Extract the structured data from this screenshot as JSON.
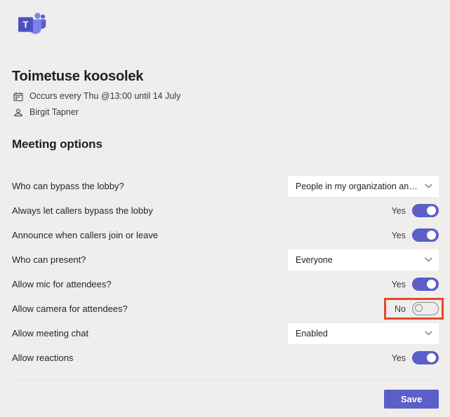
{
  "app": {
    "logo_name": "microsoft-teams-logo",
    "accent_color": "#5b5fc7",
    "background_color": "#f0eeed",
    "highlight_color": "#e8472c"
  },
  "meeting": {
    "title": "Toimetuse koosolek",
    "recurrence_icon": "calendar-icon",
    "recurrence": "Occurs every Thu @13:00 until 14 July",
    "organizer_icon": "person-icon",
    "organizer": "Birgit Tapner"
  },
  "section": {
    "title": "Meeting options"
  },
  "options": [
    {
      "label": "Who can bypass the lobby?",
      "control": "dropdown",
      "value": "People in my organization and gu...",
      "name": "who-can-bypass-lobby"
    },
    {
      "label": "Always let callers bypass the lobby",
      "control": "toggle",
      "state": "on",
      "value": "Yes",
      "name": "always-let-callers-bypass-lobby"
    },
    {
      "label": "Announce when callers join or leave",
      "control": "toggle",
      "state": "on",
      "value": "Yes",
      "name": "announce-callers-join-leave"
    },
    {
      "label": "Who can present?",
      "control": "dropdown",
      "value": "Everyone",
      "name": "who-can-present"
    },
    {
      "label": "Allow mic for attendees?",
      "control": "toggle",
      "state": "on",
      "value": "Yes",
      "name": "allow-mic-for-attendees"
    },
    {
      "label": "Allow camera for attendees?",
      "control": "toggle",
      "state": "off",
      "value": "No",
      "highlighted": true,
      "name": "allow-camera-for-attendees"
    },
    {
      "label": "Allow meeting chat",
      "control": "dropdown",
      "value": "Enabled",
      "name": "allow-meeting-chat"
    },
    {
      "label": "Allow reactions",
      "control": "toggle",
      "state": "on",
      "value": "Yes",
      "name": "allow-reactions"
    }
  ],
  "footer": {
    "save_label": "Save"
  }
}
